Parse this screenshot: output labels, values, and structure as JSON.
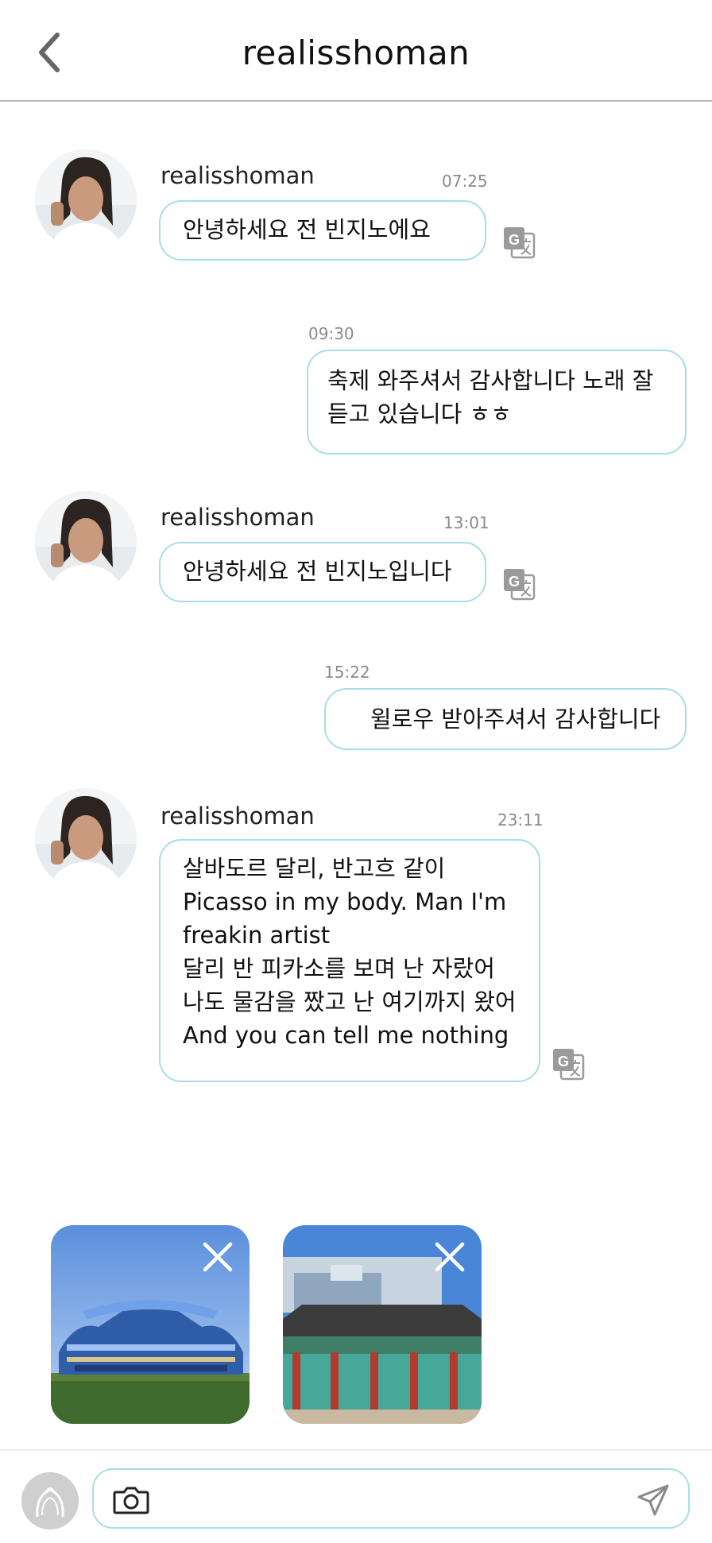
{
  "header": {
    "title": "realisshoman"
  },
  "messages": [
    {
      "sender": "realisshoman",
      "time": "07:25",
      "lines": [
        "안녕하세요 전 빈지노에요"
      ]
    },
    {
      "time": "09:30",
      "lines": [
        "축제 와주셔서 감사합니다 노래 잘",
        "듣고 있습니다 ㅎㅎ"
      ]
    },
    {
      "sender": "realisshoman",
      "time": "13:01",
      "lines": [
        "안녕하세요 전 빈지노입니다"
      ]
    },
    {
      "time": "15:22",
      "lines": [
        "윌로우 받아주셔서 감사합니다"
      ]
    },
    {
      "sender": "realisshoman",
      "time": "23:11",
      "lines": [
        "살바도르 달리, 반고흐 같이",
        "Picasso in my body. Man I'm",
        "freakin artist",
        "달리 반 피카소를 보며 난 자랐어",
        "나도 물감을 짰고 난 여기까지 왔어",
        "And you can tell me nothing"
      ]
    }
  ],
  "icons": {
    "back": "chevron-left-icon",
    "translate": "google-translate-icon",
    "close": "close-icon",
    "camera": "camera-icon",
    "send": "send-icon"
  },
  "colors": {
    "bubble_border": "#a8dde7",
    "time_text": "#8a8a8a",
    "icon_gray": "#9a9a9a"
  }
}
